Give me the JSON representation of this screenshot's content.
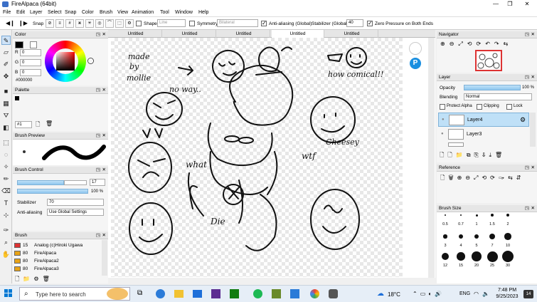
{
  "window": {
    "title": "FireAlpaca (64bit)",
    "controls": [
      "—",
      "❐",
      "✕"
    ]
  },
  "menu": [
    "File",
    "Edit",
    "Layer",
    "Select",
    "Snap",
    "Color",
    "Brush",
    "View",
    "Animation",
    "Tool",
    "Window",
    "Help"
  ],
  "toolbar": {
    "snap_label": "Snap",
    "shape_label": "Shape",
    "shape_value": "Line",
    "symmetry_label": "Symmetry",
    "symmetry_value": "Bilateral",
    "antialias_label": "Anti-aliasing (Global)",
    "stabilizer_label": "Stabilizer (Global)",
    "stabilizer_value": "40",
    "zero_pressure_label": "Zero Pressure on Both Ends"
  },
  "tabs": [
    "Untitled",
    "Untitled",
    "Untitled",
    "Untitled",
    "Untitled"
  ],
  "color_panel": {
    "title": "Color",
    "r_label": "R",
    "r": "0",
    "g_label": "G",
    "g": "0",
    "b_label": "B",
    "b": "0",
    "hex": "#000000"
  },
  "palette_panel": {
    "title": "Palette",
    "index": "#1"
  },
  "brush_preview_panel": {
    "title": "Brush Preview"
  },
  "brush_control_panel": {
    "title": "Brush Control",
    "size": "17",
    "opacity": "100 %",
    "opacity_fraction": 1.0,
    "stabilizer_label": "Stabilizer",
    "stabilizer_value": "70",
    "antialiasing_label": "Anti-aliasing",
    "antialiasing_value": "Use Global Settings"
  },
  "brush_panel": {
    "title": "Brush",
    "items": [
      {
        "size": "15",
        "name": "Analog (c)Hiroki Ugawa",
        "color": "#d33"
      },
      {
        "size": "80",
        "name": "FireAlpaca",
        "color": "#e8a317"
      },
      {
        "size": "80",
        "name": "FireAlpaca2",
        "color": "#e8a317"
      },
      {
        "size": "80",
        "name": "FireAlpaca3",
        "color": "#e8a317"
      }
    ]
  },
  "canvas_text": [
    "made",
    "by",
    "mollie",
    "no way..",
    "how comical!!",
    "Cheesey",
    "wtf",
    "what",
    "Die"
  ],
  "navigator_panel": {
    "title": "Navigator"
  },
  "layer_panel": {
    "title": "Layer",
    "opacity_label": "Opacity",
    "opacity_value": "100 %",
    "opacity_fraction": 1.0,
    "blending_label": "Blending",
    "blending_value": "Normal",
    "protect_alpha": "Protect Alpha",
    "clipping": "Clipping",
    "lock": "Lock",
    "layers": [
      "Layer4",
      "Layer3"
    ]
  },
  "reference_panel": {
    "title": "Reference"
  },
  "brush_size_panel": {
    "title": "Brush Size",
    "sizes": [
      "0.5",
      "0.7",
      "1",
      "1.5",
      "2",
      "3",
      "4",
      "5",
      "7",
      "10",
      "12",
      "15",
      "20",
      "25",
      "30"
    ]
  },
  "taskbar": {
    "search_placeholder": "Type here to search",
    "weather": "18°C",
    "language": "ENG",
    "time": "7:48 PM",
    "date": "9/25/2023",
    "notifications": "14"
  },
  "colors": {
    "accent": "#cfe3f7",
    "selected_layer": "#bfe0f7",
    "navigator_frame": "#d33"
  }
}
